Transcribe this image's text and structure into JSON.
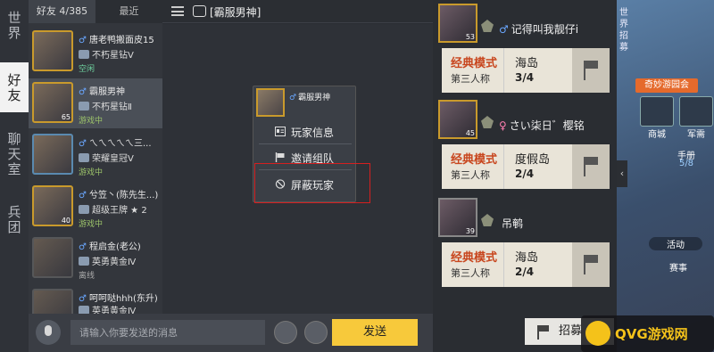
{
  "nav": {
    "tabs": [
      {
        "label": "世界"
      },
      {
        "label": "好友"
      },
      {
        "label": "聊天室"
      },
      {
        "label": "兵团"
      }
    ]
  },
  "friends": {
    "tab_friends": "好友 4/385",
    "tab_recent": "最近",
    "list": [
      {
        "name": "唐老鸭搬面皮15",
        "rank": "不朽星钻Ⅴ",
        "status": "空闲",
        "level": ""
      },
      {
        "name": "霸服男神",
        "rank": "不朽星钻Ⅱ",
        "status": "游戏中",
        "level": "65"
      },
      {
        "name": "ㄟㄟㄟㄟㄟ三...",
        "rank": "荣耀皇冠Ⅴ",
        "status": "游戏中",
        "level": ""
      },
      {
        "name": "兮笠丶(陈先生...)",
        "rank": "超级王牌 ★ 2",
        "status": "游戏中",
        "level": "40"
      },
      {
        "name": "程启金(老公)",
        "rank": "英勇黄金Ⅳ",
        "status": "离线",
        "level": ""
      },
      {
        "name": "呵呵哒hhh(东升)",
        "rank": "英勇黄金Ⅳ",
        "status": "离线",
        "level": ""
      }
    ]
  },
  "chat": {
    "title": "[霸服男神]"
  },
  "context_menu": {
    "player_name": "霸服男神",
    "items": [
      {
        "label": "玩家信息"
      },
      {
        "label": "邀请组队"
      },
      {
        "label": "屏蔽玩家"
      }
    ]
  },
  "input": {
    "placeholder": "请输入你要发送的消息",
    "send_label": "发送"
  },
  "invites": [
    {
      "name": "记得叫我靓仔i",
      "gender": "♂",
      "level": "53",
      "mode": "经典模式",
      "perspective": "第三人称",
      "map": "海岛",
      "count": "3/4"
    },
    {
      "name": "さい柒日゛樱铭",
      "gender": "♀",
      "level": "45",
      "mode": "经典模式",
      "perspective": "第三人称",
      "map": "度假岛",
      "count": "2/4"
    },
    {
      "name": "吊鹌",
      "gender": "",
      "level": "39",
      "mode": "经典模式",
      "perspective": "第三人称",
      "map": "海岛",
      "count": "2/4"
    }
  ],
  "side": {
    "vertical_label": "世界招募",
    "activity": "奇妙游园会",
    "mall": "商城",
    "armory": "军需",
    "handbook": "手册",
    "handbook_count": "5/8",
    "activity_btn": "活动",
    "event_btn": "赛事",
    "recruit": "招募"
  },
  "watermark": {
    "text": "QVG游戏网"
  }
}
